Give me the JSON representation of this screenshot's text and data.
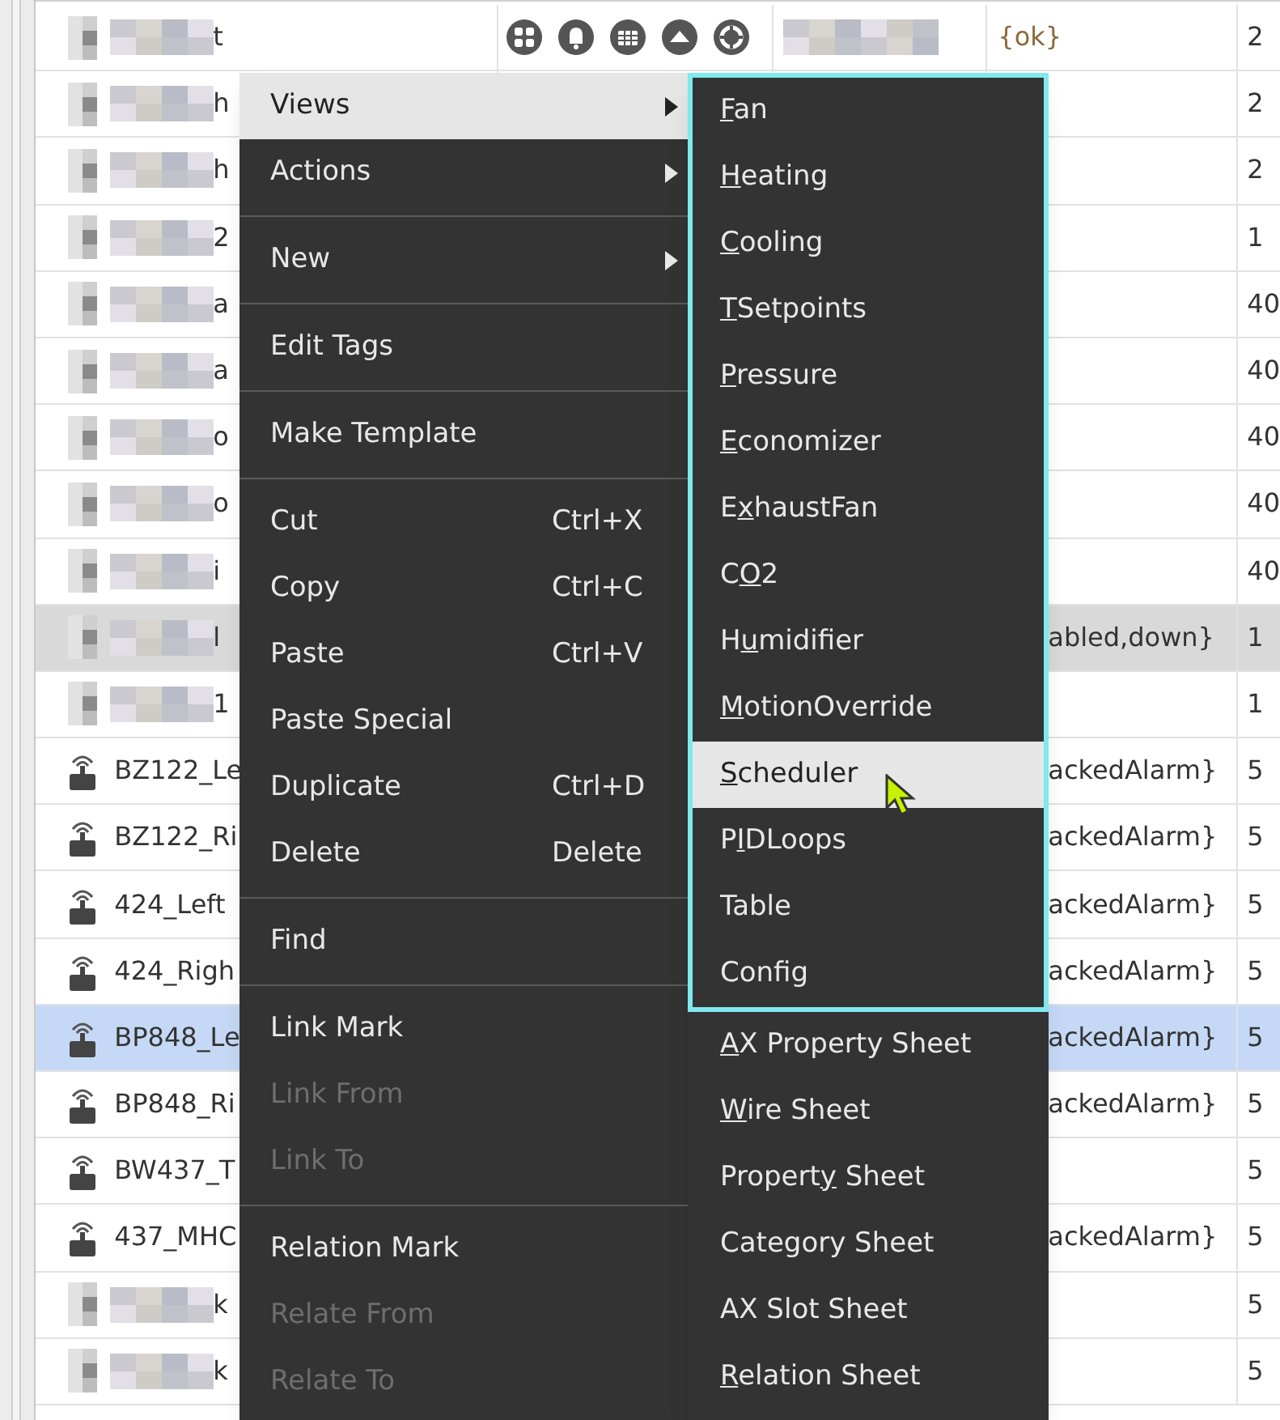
{
  "table": {
    "rows": [
      {
        "redacted": true,
        "name": "t",
        "has_action_icons": true,
        "redacted_cell": true,
        "status": "{ok}",
        "count": "2",
        "selected": false,
        "shaded": false
      },
      {
        "redacted": true,
        "name": "h",
        "status": "",
        "count": "2",
        "selected": false,
        "shaded": false
      },
      {
        "redacted": true,
        "name": "h",
        "status": "",
        "count": "2",
        "selected": false,
        "shaded": false
      },
      {
        "redacted": true,
        "name": "2",
        "status": "",
        "count": "1",
        "selected": false,
        "shaded": false
      },
      {
        "redacted": true,
        "name": "a",
        "status": "",
        "count": "40",
        "selected": false,
        "shaded": false
      },
      {
        "redacted": true,
        "name": "a",
        "status": "",
        "count": "40",
        "selected": false,
        "shaded": false
      },
      {
        "redacted": true,
        "name": "o",
        "status": "",
        "count": "40",
        "selected": false,
        "shaded": false
      },
      {
        "redacted": true,
        "name": "o",
        "status": "",
        "count": "40",
        "selected": false,
        "shaded": false
      },
      {
        "redacted": true,
        "name": "i",
        "status": "",
        "count": "40",
        "selected": false,
        "shaded": false
      },
      {
        "redacted": true,
        "name": "l",
        "status": "abled,down}",
        "count": "1",
        "selected": false,
        "shaded": true
      },
      {
        "redacted": true,
        "name": "1",
        "status": "",
        "count": "1",
        "selected": false,
        "shaded": false
      },
      {
        "redacted": false,
        "name": "BZ122_Le",
        "status": "ackedAlarm}",
        "count": "5",
        "selected": false,
        "shaded": false
      },
      {
        "redacted": false,
        "name": "BZ122_Ri",
        "status": "ackedAlarm}",
        "count": "5",
        "selected": false,
        "shaded": false
      },
      {
        "redacted": false,
        "name": "424_Left",
        "status": "ackedAlarm}",
        "count": "5",
        "selected": false,
        "shaded": false
      },
      {
        "redacted": false,
        "name": "424_Righ",
        "status": "ackedAlarm}",
        "count": "5",
        "selected": false,
        "shaded": false
      },
      {
        "redacted": false,
        "name": "BP848_Le",
        "status": "ackedAlarm}",
        "count": "5",
        "selected": true,
        "shaded": false
      },
      {
        "redacted": false,
        "name": "BP848_Ri",
        "status": "ackedAlarm}",
        "count": "5",
        "selected": false,
        "shaded": false
      },
      {
        "redacted": false,
        "name": "BW437_T",
        "status": "",
        "count": "5",
        "selected": false,
        "shaded": false
      },
      {
        "redacted": false,
        "name": "437_MHC",
        "status": "ackedAlarm}",
        "count": "5",
        "selected": false,
        "shaded": false
      },
      {
        "redacted": true,
        "name": "k",
        "status": "",
        "count": "5",
        "selected": false,
        "shaded": false
      },
      {
        "redacted": true,
        "name": "k",
        "status": "",
        "count": "5",
        "selected": false,
        "shaded": false
      }
    ]
  },
  "context_menu": {
    "items": [
      {
        "kind": "item",
        "label": "Views",
        "submenu": true,
        "selected": true,
        "disabled": false
      },
      {
        "kind": "item",
        "label": "Actions",
        "submenu": true,
        "selected": false,
        "disabled": false
      },
      {
        "kind": "separator"
      },
      {
        "kind": "item",
        "label": "New",
        "submenu": true,
        "selected": false,
        "disabled": false
      },
      {
        "kind": "separator"
      },
      {
        "kind": "item",
        "label": "Edit Tags",
        "selected": false,
        "disabled": false
      },
      {
        "kind": "separator"
      },
      {
        "kind": "item",
        "label": "Make Template",
        "selected": false,
        "disabled": false
      },
      {
        "kind": "separator"
      },
      {
        "kind": "item",
        "label": "Cut",
        "shortcut": "Ctrl+X",
        "selected": false,
        "disabled": false
      },
      {
        "kind": "item",
        "label": "Copy",
        "shortcut": "Ctrl+C",
        "selected": false,
        "disabled": false
      },
      {
        "kind": "item",
        "label": "Paste",
        "shortcut": "Ctrl+V",
        "selected": false,
        "disabled": false
      },
      {
        "kind": "item",
        "label": "Paste Special",
        "selected": false,
        "disabled": false
      },
      {
        "kind": "item",
        "label": "Duplicate",
        "shortcut": "Ctrl+D",
        "selected": false,
        "disabled": false
      },
      {
        "kind": "item",
        "label": "Delete",
        "shortcut": "Delete",
        "selected": false,
        "disabled": false
      },
      {
        "kind": "separator"
      },
      {
        "kind": "item",
        "label": "Find",
        "selected": false,
        "disabled": false
      },
      {
        "kind": "separator"
      },
      {
        "kind": "item",
        "label": "Link Mark",
        "selected": false,
        "disabled": false
      },
      {
        "kind": "item",
        "label": "Link From",
        "selected": false,
        "disabled": true
      },
      {
        "kind": "item",
        "label": "Link To",
        "selected": false,
        "disabled": true
      },
      {
        "kind": "separator"
      },
      {
        "kind": "item",
        "label": "Relation Mark",
        "selected": false,
        "disabled": false
      },
      {
        "kind": "item",
        "label": "Relate From",
        "selected": false,
        "disabled": true
      },
      {
        "kind": "item",
        "label": "Relate To",
        "selected": false,
        "disabled": true
      }
    ]
  },
  "views_submenu": {
    "framed_items": [
      {
        "key": "F",
        "after": "an",
        "selected": false
      },
      {
        "key": "H",
        "after": "eating",
        "selected": false
      },
      {
        "key": "C",
        "after": "ooling",
        "selected": false
      },
      {
        "key": "T",
        "after": "Setpoints",
        "selected": false
      },
      {
        "key": "P",
        "after": "ressure",
        "selected": false
      },
      {
        "key": "E",
        "after": "conomizer",
        "selected": false
      },
      {
        "before": "E",
        "key": "x",
        "after": "haustFan",
        "selected": false
      },
      {
        "before": "C",
        "key": "O",
        "after": "2",
        "selected": false
      },
      {
        "before": "H",
        "key": "u",
        "after": "midifier",
        "selected": false
      },
      {
        "key": "M",
        "after": "otionOverride",
        "selected": false
      },
      {
        "key": "S",
        "after": "cheduler",
        "selected": true
      },
      {
        "before": "P",
        "key": "I",
        "after": "DLoops",
        "selected": false
      },
      {
        "before": "Table",
        "selected": false
      },
      {
        "before": "Config",
        "selected": false
      }
    ],
    "items": [
      {
        "key": "A",
        "after": "X Property Sheet",
        "selected": false
      },
      {
        "key": "W",
        "after": "ire Sheet",
        "selected": false
      },
      {
        "before": "Propert",
        "key": "y",
        "after": " Sheet",
        "selected": false
      },
      {
        "before": "Category Sheet",
        "selected": false
      },
      {
        "before": "AX Slot Sheet",
        "selected": false
      },
      {
        "key": "R",
        "after": "elation Sheet",
        "selected": false
      }
    ]
  }
}
